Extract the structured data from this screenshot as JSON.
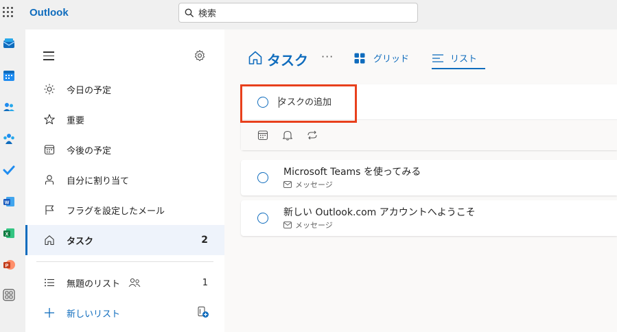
{
  "app": {
    "title": "Outlook"
  },
  "search": {
    "placeholder": "検索"
  },
  "nav": {
    "items": [
      {
        "label": "今日の予定"
      },
      {
        "label": "重要"
      },
      {
        "label": "今後の予定"
      },
      {
        "label": "自分に割り当て"
      },
      {
        "label": "フラグを設定したメール"
      },
      {
        "label": "タスク",
        "count": "2"
      }
    ],
    "lists": [
      {
        "label": "無題のリスト",
        "count": "1"
      }
    ],
    "new_list_label": "新しいリスト"
  },
  "main": {
    "title": "タスク",
    "more": "···",
    "view_grid": "グリッド",
    "view_list": "リスト",
    "add_task_placeholder": "タスクの追加",
    "tasks": [
      {
        "title": "Microsoft Teams を使ってみる",
        "source": "メッセージ"
      },
      {
        "title": "新しい Outlook.com アカウントへようこそ",
        "source": "メッセージ"
      }
    ]
  },
  "colors": {
    "accent": "#0f6cbd",
    "highlight": "#e8401c"
  }
}
